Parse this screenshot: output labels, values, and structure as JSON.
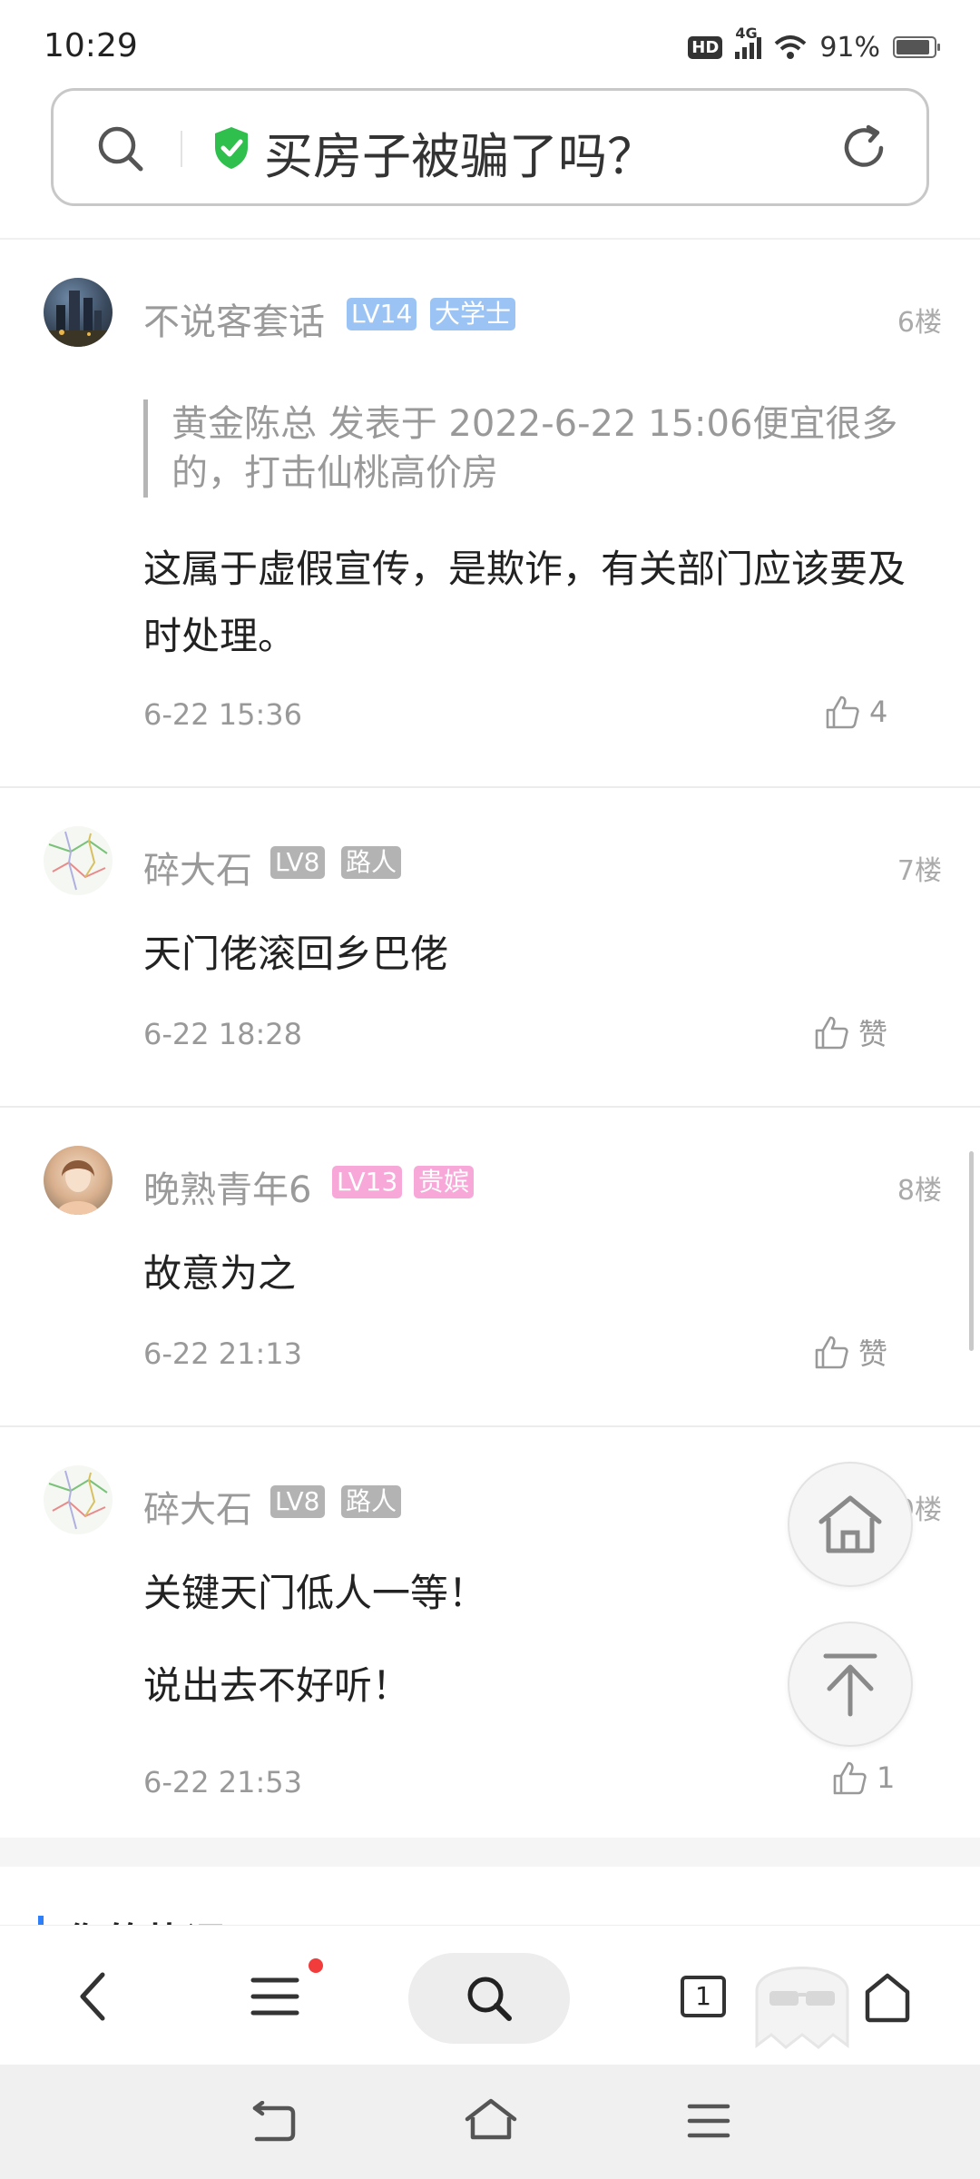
{
  "status_bar": {
    "time": "10:29",
    "hd_label": "HD",
    "network_label": "4G",
    "battery_text": "91%",
    "battery_level": 0.91
  },
  "search": {
    "query": "买房子被骗了吗？",
    "search_icon": "search-icon",
    "safe_icon": "shield-check-icon",
    "reload_icon": "reload-icon"
  },
  "posts": [
    {
      "username": "不说客套话",
      "level": "LV14",
      "title": "大学士",
      "level_color": "#9bc4f5",
      "title_color": "#9bc4f5",
      "floor": "6楼",
      "quote": "黄金陈总 发表于 2022-6-22 15:06便宜很多的，打击仙桃高价房",
      "lines": [
        "这属于虚假宣传，是欺诈，有关部门应该要及时处理。"
      ],
      "time": "6-22 15:36",
      "like": "4"
    },
    {
      "username": "碎大石",
      "level": "LV8",
      "title": "路人",
      "level_color": "#b3b3b3",
      "title_color": "#b3b3b3",
      "floor": "7楼",
      "lines": [
        "天门佬滚回乡巴佬"
      ],
      "time": "6-22 18:28",
      "like": "赞"
    },
    {
      "username": "晚熟青年6",
      "level": "LV13",
      "title": "贵嫔",
      "level_color": "#f7a8d8",
      "title_color": "#f7a8d8",
      "floor": "8楼",
      "lines": [
        "故意为之"
      ],
      "time": "6-22 21:13",
      "like": "赞"
    },
    {
      "username": "碎大石",
      "level": "LV8",
      "title": "路人",
      "level_color": "#b3b3b3",
      "title_color": "#b3b3b3",
      "floor": "9楼",
      "lines": [
        "关键天门低人一等！",
        "说出去不好听！"
      ],
      "time": "6-22 21:53",
      "like": "1"
    }
  ],
  "section": {
    "title": "你的热评"
  },
  "toolbar": {
    "tabs_count": "1",
    "icons": [
      "back-icon",
      "menu-icon",
      "search-icon",
      "tabs-icon",
      "incognito-icon",
      "home-icon"
    ]
  },
  "fab": {
    "home_icon": "home-icon",
    "top_icon": "scroll-top-icon"
  }
}
